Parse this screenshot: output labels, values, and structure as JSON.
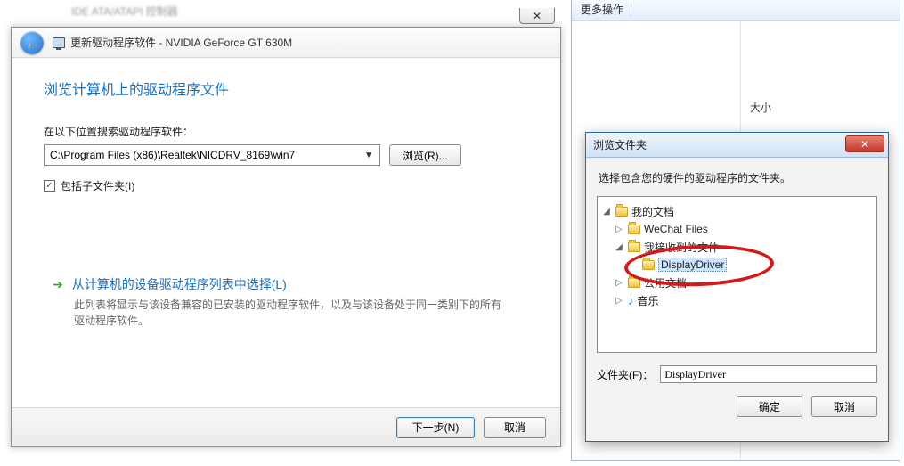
{
  "bg": {
    "ata": "IDE ATA/ATAPI 控制器"
  },
  "right": {
    "more": "更多操作",
    "size_col": "大小"
  },
  "wizard": {
    "back_glyph": "←",
    "title": "更新驱动程序软件 - NVIDIA GeForce GT 630M",
    "close_glyph": "✕",
    "heading": "浏览计算机上的驱动程序文件",
    "path_label": "在以下位置搜索驱动程序软件：",
    "path_value": "C:\\Program Files (x86)\\Realtek\\NICDRV_8169\\win7",
    "browse_btn": "浏览(R)...",
    "include_sub": "包括子文件夹(I)",
    "opt_title": "从计算机的设备驱动程序列表中选择(L)",
    "opt_desc": "此列表将显示与该设备兼容的已安装的驱动程序软件，以及与该设备处于同一类别下的所有驱动程序软件。",
    "next": "下一步(N)",
    "cancel": "取消"
  },
  "browse": {
    "title": "浏览文件夹",
    "instruction": "选择包含您的硬件的驱动程序的文件夹。",
    "tree": {
      "root": "我的文档",
      "n1": "WeChat Files",
      "n2": "我接收到的文件",
      "n3": "DisplayDriver",
      "n4": "公用文档",
      "n5": "音乐"
    },
    "folder_label": "文件夹(F)：",
    "folder_value": "DisplayDriver",
    "ok": "确定",
    "cancel": "取消"
  }
}
